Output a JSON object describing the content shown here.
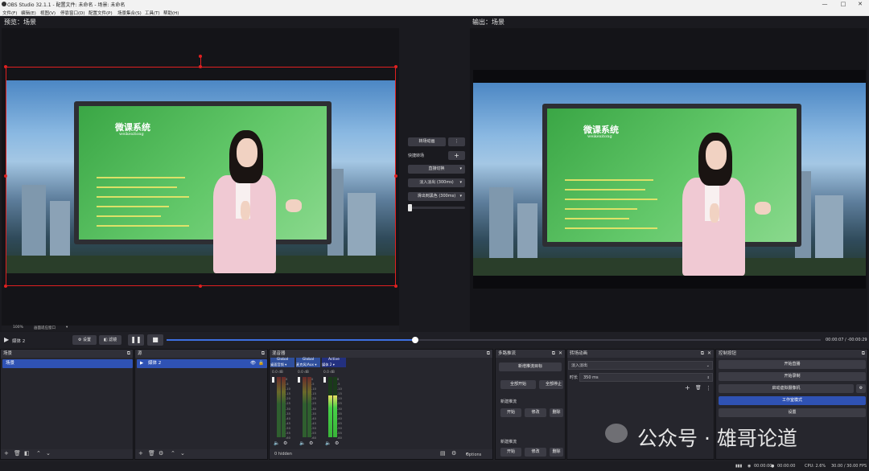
{
  "titlebar": {
    "title": "OBS Studio 32.1.1 - 配置文件: 未命名 - 场景: 未命名",
    "min": "—",
    "max": "□",
    "close": "✕"
  },
  "menu": [
    "文件(F)",
    "编辑(E)",
    "视图(V)",
    "停靠窗口(D)",
    "配置文件(P)",
    "场景集合(S)",
    "工具(T)",
    "帮助(H)"
  ],
  "preview": {
    "label": "预览：场景"
  },
  "program": {
    "label": "输出：场景"
  },
  "board": {
    "title": "微课系统",
    "subtitle": "weikexitong"
  },
  "transition": {
    "button": "转场动画",
    "more": "⋮",
    "quick_label": "快捷转场",
    "add": "+",
    "items": [
      {
        "label": "直接切换"
      },
      {
        "label": "淡入淡出 (300ms)"
      },
      {
        "label": "滑出到黑色 (300ms)"
      }
    ]
  },
  "preview_bottom": {
    "zoom": "100%",
    "label": "画面适应窗口"
  },
  "playbar": {
    "source_name": "媒体 2",
    "properties": "设置",
    "filters": "滤镜",
    "time": "00:00:07 / -00:00:29",
    "progress": 0.38
  },
  "docks": {
    "scenes": {
      "title": "场景",
      "float": "⧉",
      "items": [
        "场景"
      ]
    },
    "sources": {
      "title": "源",
      "float": "⧉",
      "items": [
        "媒体 2"
      ]
    },
    "mixer": {
      "title": "混音器",
      "float": "⧉",
      "footer": "0 hidden",
      "channels": [
        {
          "tag": "Global",
          "name": "桌面音频",
          "db": "0.0 dB",
          "color": "#3a66c4"
        },
        {
          "tag": "Global",
          "name": "麦克风/Aux",
          "db": "0.0 dB",
          "color": "#3a66c4"
        },
        {
          "tag": "Active",
          "name": "媒体 2",
          "db": "0.0 dB",
          "color": "#2e3aa8"
        }
      ],
      "scale": [
        "0",
        "-5",
        "-10",
        "-15",
        "-20",
        "-25",
        "-30",
        "-35",
        "-40",
        "-45",
        "-50",
        "-55",
        "-60"
      ],
      "options": "Options"
    },
    "multiview": {
      "title": "多路推流",
      "float": "⧉",
      "close": "✕",
      "new_btn": "新增推流目标",
      "start_all": "全部开始",
      "stop_all": "全部停止",
      "group1": "新建推流",
      "group2": "新建推流",
      "start": "开始",
      "edit": "修改",
      "del": "删除"
    },
    "transitions": {
      "title": "转场动画",
      "float": "⧉",
      "close": "✕",
      "selected": "淡入淡出",
      "duration_label": "时长",
      "duration": "350 ms"
    },
    "controls": {
      "title": "控制按钮",
      "float": "⧉",
      "buttons": [
        "开始直播",
        "开始录制",
        "启动虚拟摄像机",
        "工作室模式",
        "设置"
      ]
    }
  },
  "statusbar": {
    "rec": "00:00:00",
    "stream": "00:00:00",
    "cpu": "CPU: 2.6%",
    "fps": "30.00 / 30.00 FPS"
  },
  "watermark": "公众号 · 雄哥论道",
  "colors": {
    "accent": "#2f52b4",
    "selection": "#e02020",
    "panel": "#26262d"
  }
}
